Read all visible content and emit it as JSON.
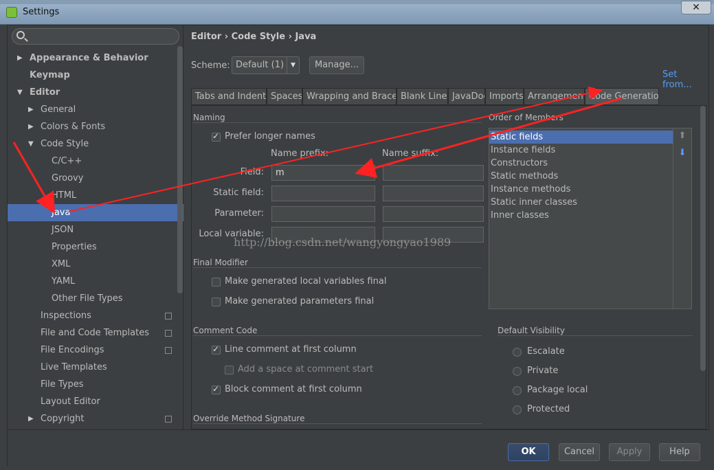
{
  "window": {
    "title": "Settings",
    "close": "✕"
  },
  "sidebar": {
    "search_placeholder": "",
    "items": [
      {
        "label": "Appearance & Behavior",
        "level": 0,
        "arrow": "▶",
        "bold": true
      },
      {
        "label": "Keymap",
        "level": 0,
        "arrow": "",
        "bold": true
      },
      {
        "label": "Editor",
        "level": 0,
        "arrow": "▼",
        "bold": true
      },
      {
        "label": "General",
        "level": 1,
        "arrow": "▶"
      },
      {
        "label": "Colors & Fonts",
        "level": 1,
        "arrow": "▶"
      },
      {
        "label": "Code Style",
        "level": 1,
        "arrow": "▼"
      },
      {
        "label": "C/C++",
        "level": 2,
        "arrow": ""
      },
      {
        "label": "Groovy",
        "level": 2,
        "arrow": ""
      },
      {
        "label": "HTML",
        "level": 2,
        "arrow": ""
      },
      {
        "label": "Java",
        "level": 2,
        "arrow": "",
        "selected": true
      },
      {
        "label": "JSON",
        "level": 2,
        "arrow": ""
      },
      {
        "label": "Properties",
        "level": 2,
        "arrow": ""
      },
      {
        "label": "XML",
        "level": 2,
        "arrow": ""
      },
      {
        "label": "YAML",
        "level": 2,
        "arrow": ""
      },
      {
        "label": "Other File Types",
        "level": 2,
        "arrow": ""
      },
      {
        "label": "Inspections",
        "level": 1,
        "arrow": "",
        "copy": true
      },
      {
        "label": "File and Code Templates",
        "level": 1,
        "arrow": "",
        "copy": true
      },
      {
        "label": "File Encodings",
        "level": 1,
        "arrow": "",
        "copy": true
      },
      {
        "label": "Live Templates",
        "level": 1,
        "arrow": ""
      },
      {
        "label": "File Types",
        "level": 1,
        "arrow": ""
      },
      {
        "label": "Layout Editor",
        "level": 1,
        "arrow": ""
      },
      {
        "label": "Copyright",
        "level": 1,
        "arrow": "▶",
        "copy": true
      }
    ]
  },
  "header": {
    "breadcrumb": "Editor › Code Style › Java",
    "scheme_label": "Scheme:",
    "scheme_value": "Default (1)",
    "manage_label": "Manage...",
    "set_from": "Set from..."
  },
  "tabs": [
    "Tabs and Indents",
    "Spaces",
    "Wrapping and Braces",
    "Blank Lines",
    "JavaDoc",
    "Imports",
    "Arrangement",
    "Code Generation"
  ],
  "active_tab": "Code Generation",
  "naming": {
    "title": "Naming",
    "prefer_longer": "Prefer longer names",
    "prefer_longer_checked": true,
    "prefix_header": "Name prefix:",
    "suffix_header": "Name suffix:",
    "rows": [
      {
        "label": "Field:",
        "prefix": "m",
        "suffix": ""
      },
      {
        "label": "Static field:",
        "prefix": "",
        "suffix": ""
      },
      {
        "label": "Parameter:",
        "prefix": "",
        "suffix": ""
      },
      {
        "label": "Local variable:",
        "prefix": "",
        "suffix": ""
      }
    ]
  },
  "order_of_members": {
    "title": "Order of Members",
    "items": [
      "Static fields",
      "Instance fields",
      "Constructors",
      "Static methods",
      "Instance methods",
      "Static inner classes",
      "Inner classes"
    ],
    "selected": "Static fields",
    "up_icon": "⬆",
    "down_icon": "⬇"
  },
  "final_modifier": {
    "title": "Final Modifier",
    "local_vars": "Make generated local variables final",
    "params": "Make generated parameters final"
  },
  "comment_code": {
    "title": "Comment Code",
    "line_comment": "Line comment at first column",
    "add_space": "Add a space at comment start",
    "block_comment": "Block comment at first column"
  },
  "override": {
    "title": "Override Method Signature"
  },
  "default_visibility": {
    "title": "Default Visibility",
    "options": [
      "Escalate",
      "Private",
      "Package local",
      "Protected"
    ]
  },
  "watermark": "http://blog.csdn.net/wangyongyao1989",
  "footer": {
    "ok": "OK",
    "cancel": "Cancel",
    "apply": "Apply",
    "help": "Help"
  },
  "colors": {
    "accent": "#4b6eaf",
    "link": "#589df6",
    "arrow": "#ff2222"
  }
}
